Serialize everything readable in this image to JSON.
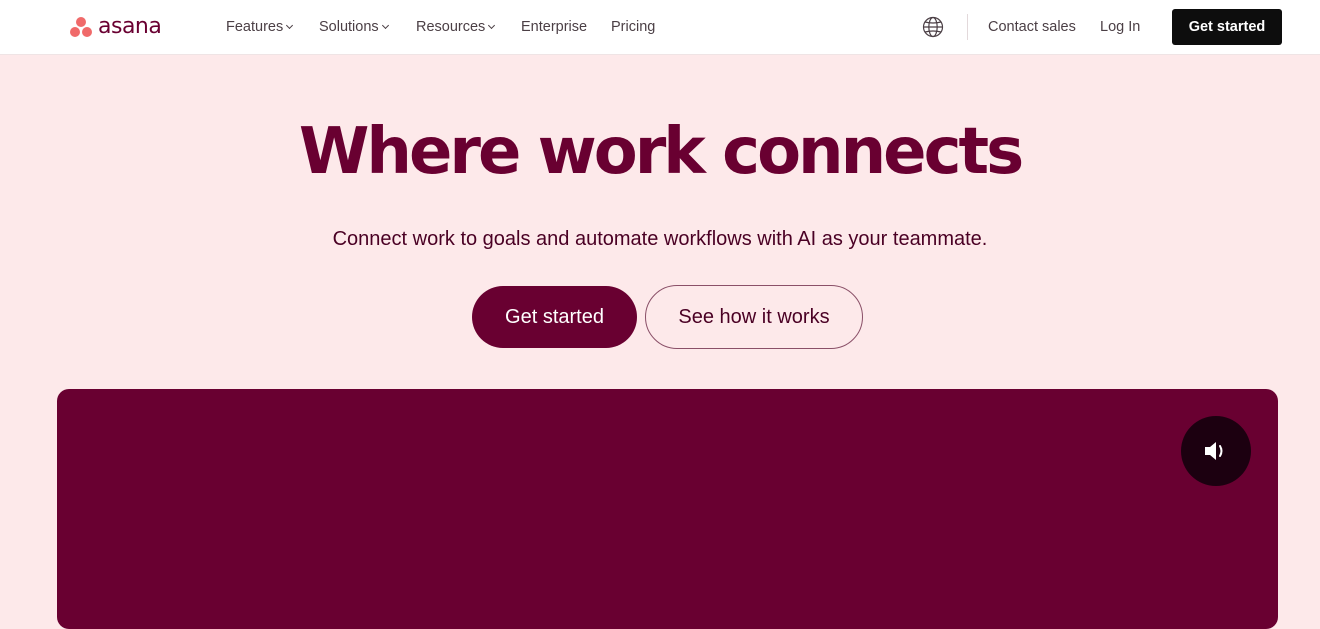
{
  "brand": {
    "logo_text": "asana",
    "logo_color": "#690031",
    "mark_color": "#f06a6a"
  },
  "nav": {
    "items": [
      {
        "label": "Features",
        "has_dropdown": true
      },
      {
        "label": "Solutions",
        "has_dropdown": true
      },
      {
        "label": "Resources",
        "has_dropdown": true
      },
      {
        "label": "Enterprise",
        "has_dropdown": false
      },
      {
        "label": "Pricing",
        "has_dropdown": false
      }
    ],
    "language_icon": "globe-icon",
    "contact_sales": "Contact sales",
    "log_in": "Log In",
    "get_started": "Get started"
  },
  "hero": {
    "title": "Where work connects",
    "subtitle": "Connect work to goals and automate workflows with AI as your teammate.",
    "primary_cta": "Get started",
    "secondary_cta": "See how it works"
  },
  "video": {
    "background_color": "#690031",
    "sound_icon": "speaker-icon"
  },
  "colors": {
    "page_background": "#fde9ea",
    "accent": "#690031",
    "nav_button": "#0d0d0d"
  }
}
